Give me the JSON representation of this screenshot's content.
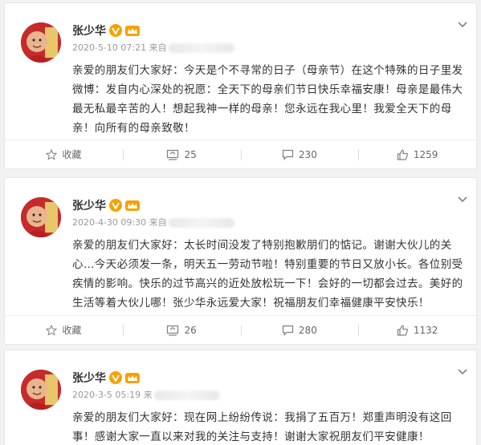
{
  "posts": [
    {
      "author": "张少华",
      "time": "2020-5-10 07:21",
      "source_prefix": "来自",
      "content": "亲爱的朋友们大家好：今天是个不寻常的日子（母亲节）在这个特殊的日子里发微博：发自内心深处的祝愿：全天下的母亲们节日快乐幸福安康！母亲是最伟大最无私最辛苦的人！想起我神一样的母亲！您永远在我心里！我爱全天下的母亲！向所有的母亲致敬！",
      "favorite_label": "收藏",
      "reposts": "25",
      "comments": "230",
      "likes": "1259"
    },
    {
      "author": "张少华",
      "time": "2020-4-30 09:30",
      "source_prefix": "来自",
      "content": "亲爱的朋友们大家好：太长时间没发了特别抱歉朋们的惦记。谢谢大伙儿的关心…今天必须发一条，明天五一劳动节啦！特别重要的节日又放小长。各位别受疾情的影响。快乐的过节高兴的近处放松玩一下！会好的一切都会过去。美好的生活等着大伙儿哪！张少华永远爱大家！祝福朋友们幸福健康平安快乐！",
      "favorite_label": "收藏",
      "reposts": "26",
      "comments": "280",
      "likes": "1132"
    },
    {
      "author": "张少华",
      "time": "2020-3-5 05:19",
      "source_prefix": "来",
      "content": "亲爱的朋友们大家好：现在网上纷纷传说：我捐了五百万！郑重声明没有这回事！感谢大家一直以来对我的关注与支持！谢谢大家祝朋友们平安健康！",
      "favorite_label": "收藏",
      "reposts": "",
      "comments": "",
      "likes": ""
    }
  ],
  "colors": {
    "accent_orange": "#f7a100",
    "icon_gray": "#808080",
    "text": "#333333",
    "meta": "#999999",
    "avatar_bg": "#c62b2b"
  },
  "icons": {
    "verified": "verified-v-icon",
    "crown": "crown-icon",
    "menu": "chevron-down-icon",
    "favorite": "star-icon",
    "repost": "repost-icon",
    "comment": "comment-icon",
    "like": "thumbs-up-icon"
  }
}
